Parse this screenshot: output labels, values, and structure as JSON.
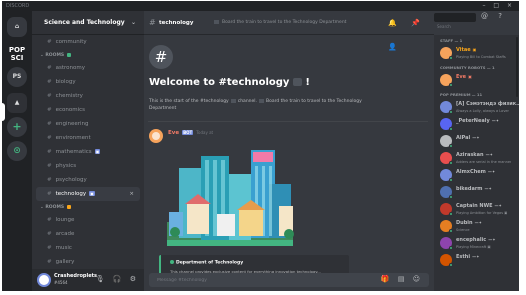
{
  "window": {
    "title": "DISCORD",
    "controls": "– □ ×"
  },
  "rail": {
    "servers": [
      {
        "name": "discord-home",
        "label": "⌂"
      },
      {
        "name": "popsci",
        "label": "POP SCI"
      },
      {
        "name": "ps",
        "label": "PS"
      },
      {
        "name": "science-tech",
        "label": "▲"
      },
      {
        "name": "add-server",
        "label": "+"
      },
      {
        "name": "explore",
        "label": "⊙"
      }
    ]
  },
  "sidebar": {
    "guild_name": "Science and Technology",
    "top_channel": "community",
    "categories": [
      {
        "label": "ROOMS",
        "dot": "green",
        "channels": [
          "astronomy",
          "biology",
          "chemistry",
          "economics",
          "engineering",
          "environment",
          "mathematics",
          "physics",
          "psychology",
          "technology"
        ]
      },
      {
        "label": "ROOMS",
        "dot": "orange",
        "channels": [
          "lounge",
          "arcade",
          "music",
          "gallery"
        ]
      }
    ],
    "tags": {
      "mathematics": "▣",
      "technology": "▣"
    },
    "active_channel": "technology"
  },
  "user": {
    "name": "Crashedroplets",
    "tag": "#4564",
    "icons": "🎙 🎧 ⚙"
  },
  "header": {
    "channel": "technology",
    "topic": "Board the train to travel to the Technology Department",
    "icons": "🔔 📌 👤"
  },
  "search": {
    "placeholder": "Search"
  },
  "right_icons": "@ ?",
  "welcome": {
    "hash": "#",
    "title": "Welcome to #technology",
    "trail": "!",
    "subtitle_a": "This is the start of the #technology",
    "subtitle_b": "channel.",
    "subtitle_c": "Board the train to travel to the Technology Department"
  },
  "message": {
    "author": "Eve",
    "bot_tag": "BOT",
    "time": "Today at",
    "embed_title": "Department of Technology",
    "embed_desc": "This channel provides exclusive content for everything innovation technology..."
  },
  "composer": {
    "placeholder": "Message #technology",
    "icons": "🎁 ▤ ☺"
  },
  "member_groups": [
    {
      "label": "STAFF — 1",
      "members": [
        {
          "name": "Vitae",
          "color": "#faa61a",
          "sub": "Playing Bill to Combat Staffs",
          "av": "#f6a35c",
          "pin": "▣"
        }
      ]
    },
    {
      "label": "COMMUNITY ROBOTS — 1",
      "members": [
        {
          "name": "Eve",
          "color": "#f47b67",
          "sub": "",
          "av": "#f6a35c",
          "pin": "▣"
        }
      ]
    },
    {
      "label": "POP PREMIUM — 11",
      "members": [
        {
          "name": "[A] Сэмэтэндэ физик…",
          "color": "#b9bbbe",
          "sub": "Always a Lolly, always a Lover",
          "av": "#7289da",
          "pin": ""
        },
        {
          "name": "_PeterNealy",
          "color": "#b9bbbe",
          "sub": "",
          "av": "#5865f2",
          "pin": "—✦"
        },
        {
          "name": "AlPal",
          "color": "#b9bbbe",
          "sub": "",
          "av": "#b9bbbe",
          "pin": "—✦"
        },
        {
          "name": "Aziraskan",
          "color": "#b9bbbe",
          "sub": "Adders are serial in the manner",
          "av": "#e84e4e",
          "pin": "—✦"
        },
        {
          "name": "AlmxChem",
          "color": "#b9bbbe",
          "sub": "",
          "av": "#7289da",
          "pin": "—✦"
        },
        {
          "name": "bikedarm",
          "color": "#b9bbbe",
          "sub": "",
          "av": "#4f6fb0",
          "pin": "—✦"
        },
        {
          "name": "Captain NWE",
          "color": "#b9bbbe",
          "sub": "Playing Ambition for Vegas ▣",
          "av": "#c0392b",
          "pin": "—✦"
        },
        {
          "name": "Dubin",
          "color": "#b9bbbe",
          "sub": "Science",
          "av": "#e67e22",
          "pin": "—✦"
        },
        {
          "name": "encephalic",
          "color": "#b9bbbe",
          "sub": "Playing Minecraft ▣",
          "av": "#8e44ad",
          "pin": "—✦"
        },
        {
          "name": "Esthi",
          "color": "#b9bbbe",
          "sub": "",
          "av": "#d35400",
          "pin": "—✦"
        }
      ]
    }
  ]
}
